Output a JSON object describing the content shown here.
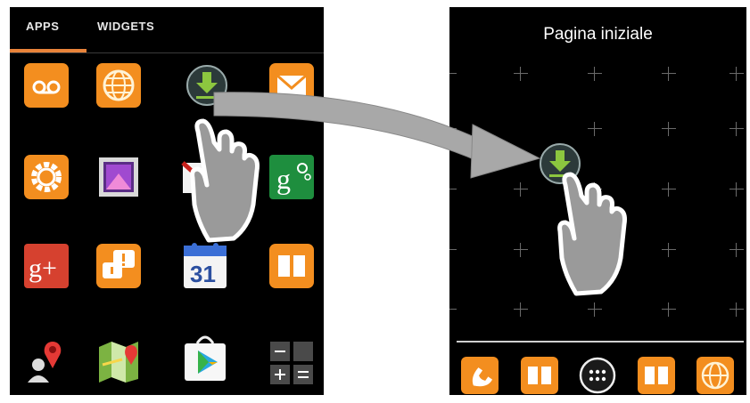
{
  "drawer": {
    "tabs": [
      {
        "label": "APPS",
        "active": true
      },
      {
        "label": "WIDGETS",
        "active": false
      }
    ],
    "apps": [
      {
        "icon": "voicemail-icon"
      },
      {
        "icon": "browser-globe-icon"
      },
      {
        "icon": "downloads-icon"
      },
      {
        "icon": "email-icon"
      },
      {
        "icon": "settings-icon"
      },
      {
        "icon": "gallery-icon"
      },
      {
        "icon": "gmail-icon"
      },
      {
        "icon": "google-settings-icon",
        "text": "g"
      },
      {
        "icon": "google-plus-icon",
        "text": "g+"
      },
      {
        "icon": "messenger-icon"
      },
      {
        "icon": "calendar-icon",
        "text": "31"
      },
      {
        "icon": "book-icon"
      },
      {
        "icon": "latitude-icon"
      },
      {
        "icon": "maps-icon"
      },
      {
        "icon": "play-store-icon"
      },
      {
        "icon": "calculator-icon"
      }
    ]
  },
  "home": {
    "title": "Pagina iniziale",
    "dock": [
      {
        "icon": "phone-icon"
      },
      {
        "icon": "book-icon"
      },
      {
        "icon": "all-apps-icon"
      },
      {
        "icon": "book-icon"
      },
      {
        "icon": "browser-globe-icon"
      }
    ]
  },
  "colors": {
    "accent_orange": "#f38e1f",
    "tab_underline": "#e8833a",
    "download_green": "#8cc63f",
    "arrow_gray": "#a8a8a8"
  }
}
